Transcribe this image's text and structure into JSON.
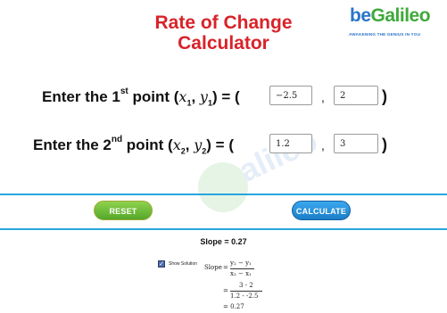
{
  "header": {
    "title_line1": "Rate of Change",
    "title_line2": "Calculator"
  },
  "logo": {
    "part1": "be",
    "part2": "Galileo",
    "tagline": "AWAKENING THE GENIUS IN YOU"
  },
  "row1": {
    "label_prefix": "Enter the 1",
    "label_sup": "st",
    "label_mid": " point (",
    "x": "x",
    "x_sub": "1",
    "sep": ", ",
    "y": "y",
    "y_sub": "1",
    "label_end": ") = (",
    "x_value": "−2.5",
    "y_value": "2"
  },
  "row2": {
    "label_prefix": "Enter the 2",
    "label_sup": "nd",
    "label_mid": " point (",
    "x": "x",
    "x_sub": "2",
    "sep": ", ",
    "y": "y",
    "y_sub": "2",
    "label_end": ") = (",
    "x_value": "1.2",
    "y_value": "3"
  },
  "punct": {
    "comma": ",",
    "close": ")"
  },
  "buttons": {
    "reset_label": "RESET",
    "calculate_label": "CALCULATE"
  },
  "result": {
    "slope_text": "Slope = 0.27"
  },
  "solution": {
    "checkbox_checked": true,
    "show_label": "Show Solution",
    "slope_word": "Slope",
    "equals": "=",
    "formula_num": "y₂ − y₁",
    "formula_den": "x₂ − x₁",
    "step_num": "3 - 2",
    "step_den": "1.2 - -2.5",
    "final": "= 0.27"
  },
  "colors": {
    "title": "#d8232a",
    "divider": "#27a6df",
    "reset": "#6cbd3a",
    "calculate": "#2a8fdb"
  }
}
